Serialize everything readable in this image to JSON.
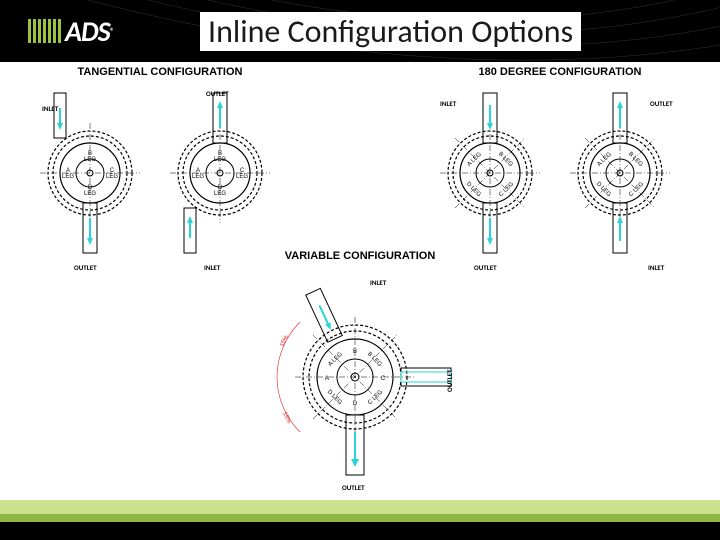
{
  "header": {
    "logo_text": "ADS",
    "title": "Inline Configuration Options"
  },
  "configs": {
    "tangential": {
      "title": "TANGENTIAL CONFIGURATION"
    },
    "deg180": {
      "title": "180 DEGREE CONFIGURATION"
    },
    "variable": {
      "title": "VARIABLE CONFIGURATION"
    }
  },
  "labels": {
    "inlet": "INLET",
    "outlet": "OUTLET",
    "leg_a": "A LEG",
    "leg_b": "B LEG",
    "leg_c": "C LEG",
    "leg_d": "D LEG",
    "dim_15": "15%"
  }
}
